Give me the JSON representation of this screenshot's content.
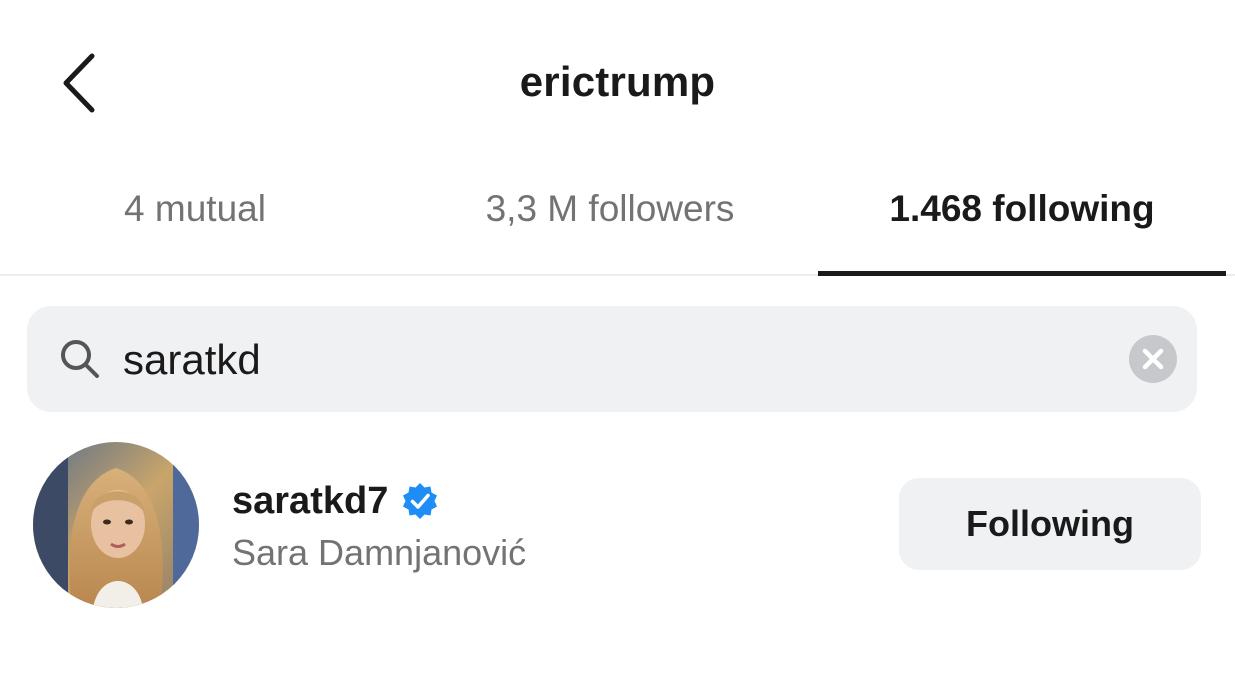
{
  "header": {
    "title": "erictrump",
    "back_icon": "chevron-left-icon"
  },
  "tabs": [
    {
      "label": "4 mutual",
      "active": false
    },
    {
      "label": "3,3 M followers",
      "active": false
    },
    {
      "label": "1.468 following",
      "active": true
    }
  ],
  "search": {
    "value": "saratkd",
    "placeholder": "",
    "search_icon": "search-icon",
    "clear_icon": "clear-icon"
  },
  "results": [
    {
      "username": "saratkd7",
      "full_name": "Sara Damnjanović",
      "verified": true,
      "button_label": "Following"
    }
  ],
  "colors": {
    "text_primary": "#1a1a1a",
    "text_secondary": "#737373",
    "search_background": "#eff1f3",
    "verified_blue": "#1e8ef6",
    "button_background": "#eff1f3"
  }
}
